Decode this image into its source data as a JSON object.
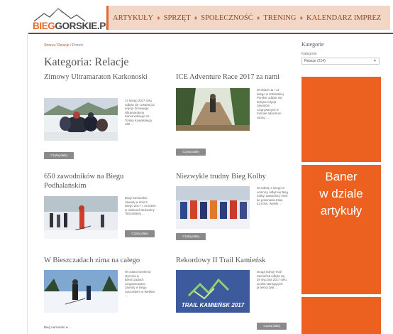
{
  "header": {
    "logo": {
      "part_a": "BIEG",
      "part_b": "GORSKIE.PL"
    },
    "nav": [
      "ARTYKUŁY",
      "SPRZĘT",
      "SPOŁECZNOŚĆ",
      "TRENING",
      "KALENDARZ IMPREZ"
    ],
    "separator": "♦"
  },
  "breadcrumb": {
    "home": "Strona",
    "section": "Relacje",
    "current": "Pomoc"
  },
  "page_title": "Kategoria: Relacje",
  "articles": [
    {
      "title": "Zimowy Ultramaraton Karkonoski",
      "excerpt": "14 lutego 2017 roku odbyła się czwarta już edycja Zimowego Ultramaratonu Karkonoskiego im. Tomka Kowalskiego. 160 …",
      "button": "Czytaj dalej"
    },
    {
      "title": "ICE Adventure Race 2017 za nami",
      "excerpt": "W dniach 11 i 12 lutego w Szklarskiej Porębie odbyła się kolejna edycja zawodów rozgrywanych w formule adventure racing …",
      "button": "Czytaj dalej"
    },
    {
      "title": "650 zawodników na Biegu Podhalańskim",
      "excerpt": "Biegi narciarskie, zawody w dniu 5 lutego 2017 r. na trasie w okolicach Bukowiny Tatrzańskiej …",
      "button": "Czytaj dalej"
    },
    {
      "title": "Niezwykle trudny Bieg Kolby",
      "excerpt": "W sobotę 4 lutego w Łomnicy odbył się Bieg Kolby. Zawodnicy mieli do pokonania trasę 22,5 km. Wyniki …",
      "button": "Czytaj dalej"
    },
    {
      "title": "W Bieszczadach zima na całego",
      "excerpt": "W ostatni weekend stycznia w Bieszczadach zorganizowano zawody w biegu narciarskim w Wetlinie …",
      "footer": "Bieg narciarski w …"
    },
    {
      "title": "Rekordowy II Trail Kamieńsk",
      "excerpt": "Drugą edycję Trail Kamieńsk odbyła się 28 stycznia 2017 roku. Liczba startujących przekroczyła …",
      "button": "Czytaj dalej",
      "image_text": "TRAIL KAMIEŃSK 2017"
    }
  ],
  "sidebar": {
    "title": "Kategorie",
    "label": "Kategorie",
    "select_value": "Relacje (214)",
    "banner_lines": [
      "Baner",
      "w dziale",
      "artykuły"
    ]
  },
  "colors": {
    "accent": "#ec6120",
    "nav_bg": "#f3d7c6",
    "header_line": "#6b4a3a"
  }
}
